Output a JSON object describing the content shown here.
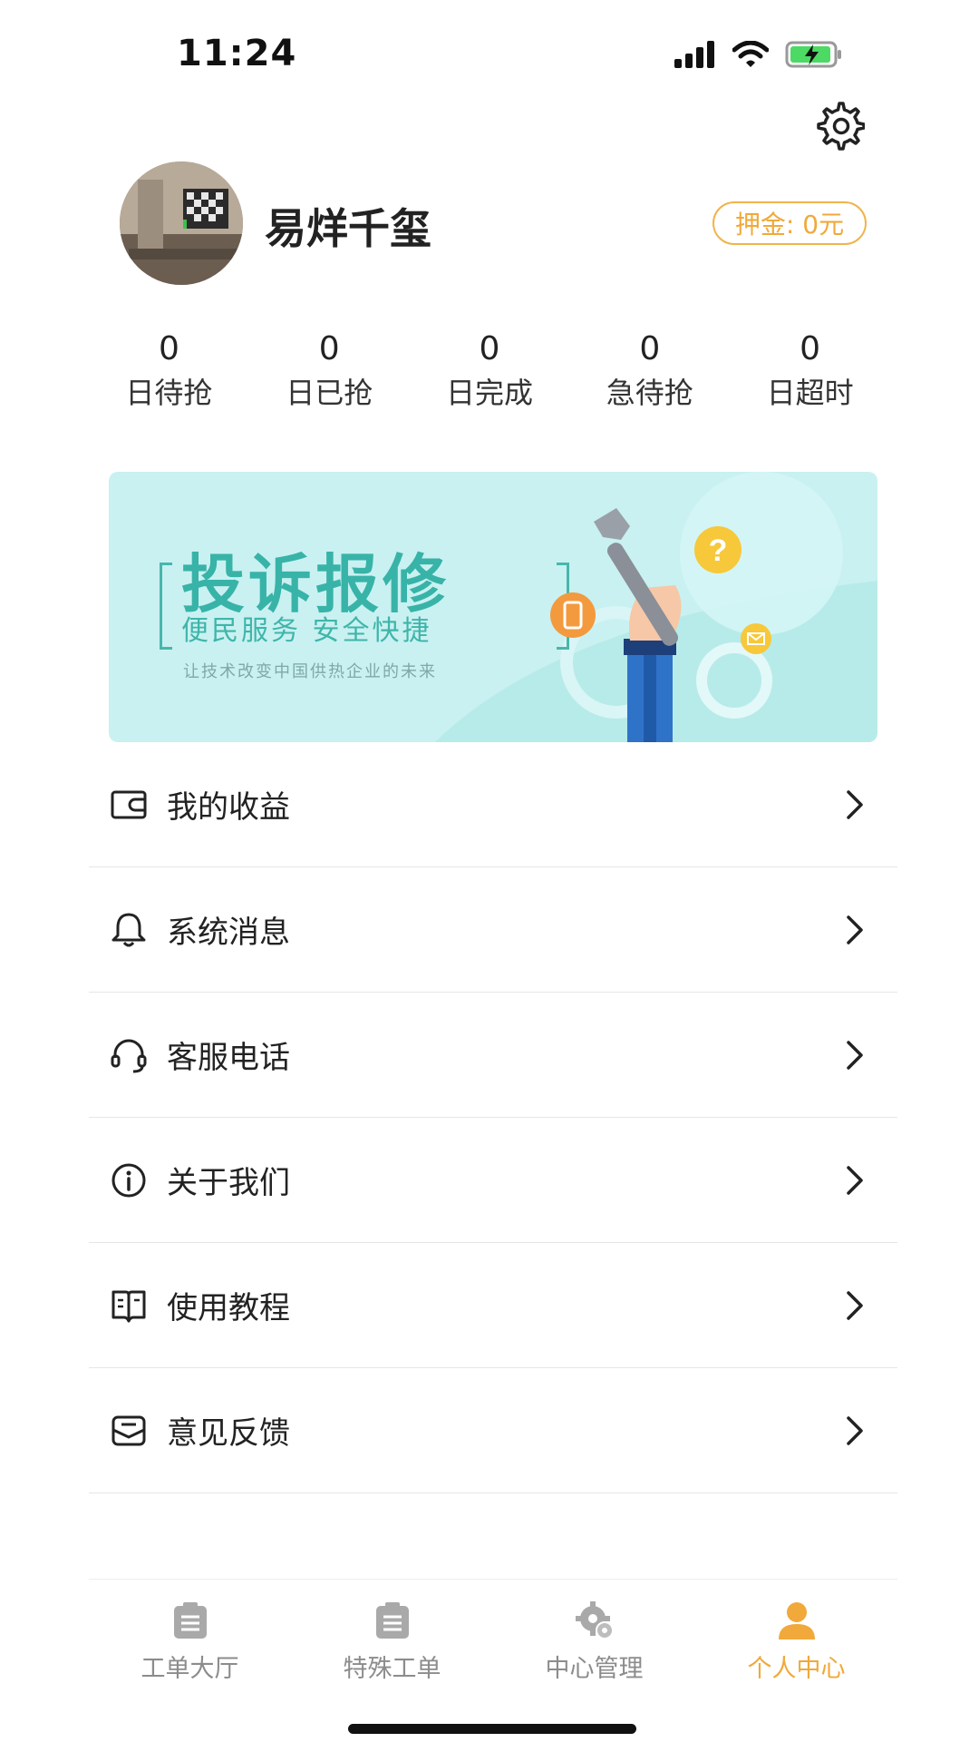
{
  "status_bar": {
    "time": "11:24"
  },
  "profile": {
    "name": "易烊千玺",
    "deposit": "押金: 0元"
  },
  "stats": [
    {
      "value": "0",
      "label": "日待抢"
    },
    {
      "value": "0",
      "label": "日已抢"
    },
    {
      "value": "0",
      "label": "日完成"
    },
    {
      "value": "0",
      "label": "急待抢"
    },
    {
      "value": "0",
      "label": "日超时"
    }
  ],
  "banner": {
    "title": "投诉报修",
    "subtitle": "便民服务  安全快捷",
    "tagline": "让技术改变中国供热企业的未来"
  },
  "menu": [
    {
      "label": "我的收益",
      "icon": "wallet-icon"
    },
    {
      "label": "系统消息",
      "icon": "bell-icon"
    },
    {
      "label": "客服电话",
      "icon": "headset-icon"
    },
    {
      "label": "关于我们",
      "icon": "info-icon"
    },
    {
      "label": "使用教程",
      "icon": "book-icon"
    },
    {
      "label": "意见反馈",
      "icon": "mail-icon"
    }
  ],
  "tabs": [
    {
      "label": "工单大厅",
      "icon": "clipboard-icon",
      "active": false
    },
    {
      "label": "特殊工单",
      "icon": "clipboard-icon",
      "active": false
    },
    {
      "label": "中心管理",
      "icon": "gear-icon",
      "active": false
    },
    {
      "label": "个人中心",
      "icon": "person-icon",
      "active": true
    }
  ],
  "colors": {
    "accent": "#f0a93a",
    "banner_bg": "#c9f1f1",
    "banner_text": "#38b3a8",
    "inactive_tab": "#8c8c8c"
  }
}
